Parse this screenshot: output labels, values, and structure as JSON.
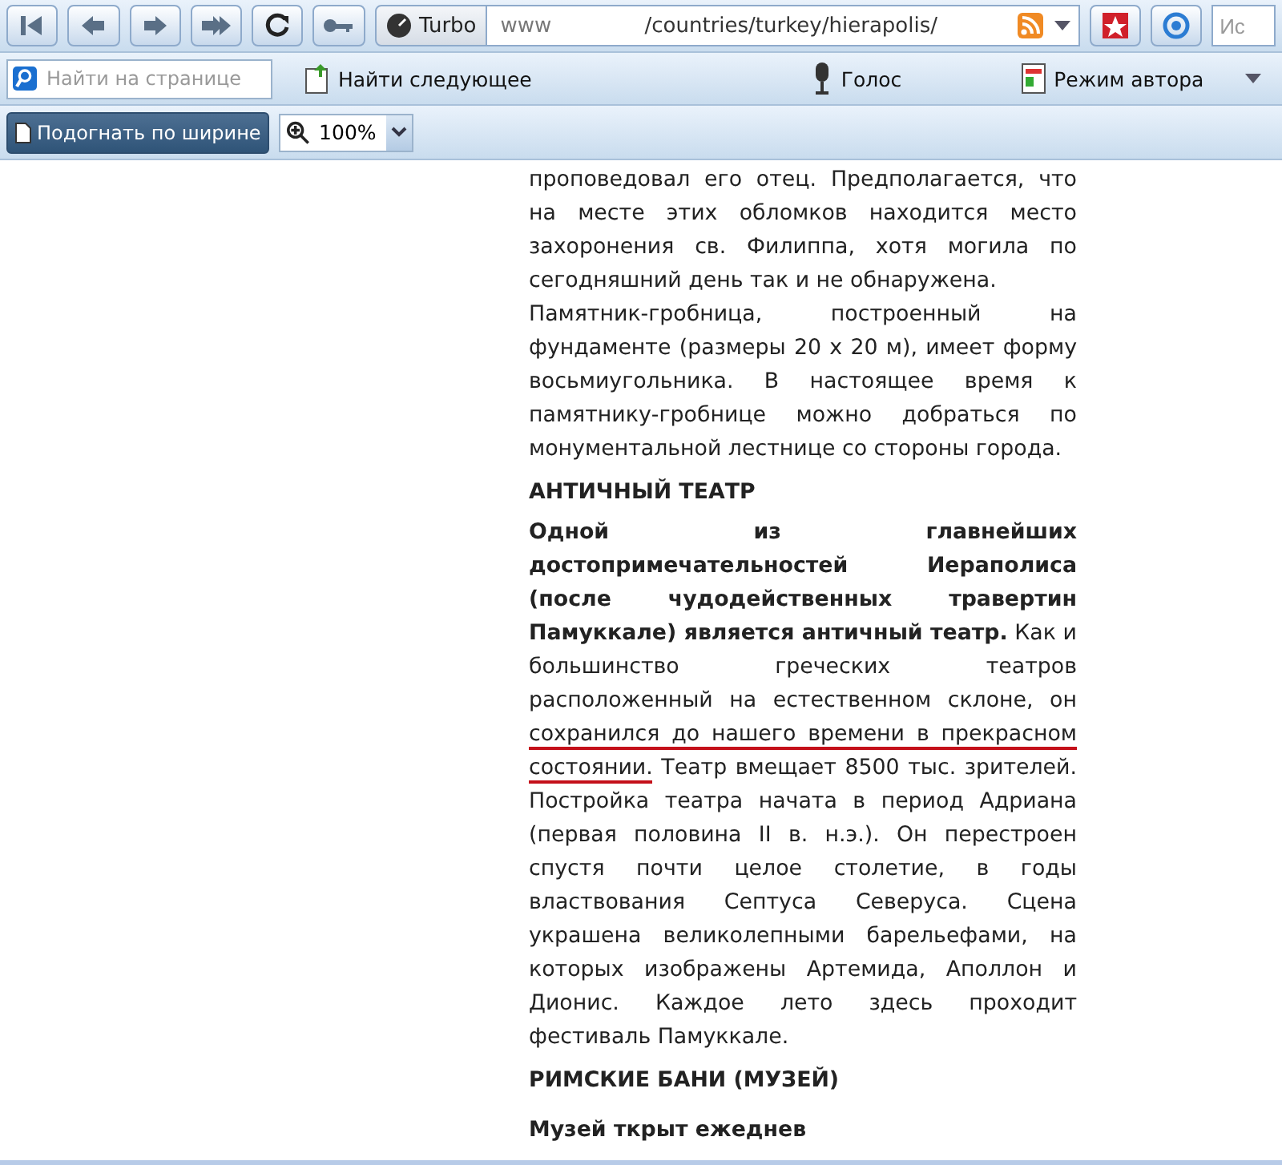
{
  "nav_toolbar": {
    "buttons": [
      {
        "kind": "first",
        "disabled": false
      },
      {
        "kind": "back",
        "disabled": false
      },
      {
        "kind": "forward",
        "disabled": false
      },
      {
        "kind": "fast-forward",
        "disabled": false
      },
      {
        "kind": "reload",
        "disabled": false
      },
      {
        "kind": "key",
        "disabled": false
      }
    ],
    "turbo": {
      "label": "Turbo"
    },
    "address": {
      "host": "www",
      "path": "/countries/turkey/hierapolis/"
    },
    "search": {
      "placeholder": "Ис"
    }
  },
  "find_bar": {
    "find_field": {
      "placeholder": "Найти на странице"
    },
    "find_next": "Найти следующее",
    "voice": "Голос",
    "author_mode": "Режим автора"
  },
  "zoom_bar": {
    "fit_width": {
      "label": "Подогнать по ширине",
      "selected": true
    },
    "zoom": "100%"
  },
  "article": [
    {
      "kind": "para",
      "segments": [
        {
          "kind": "plain",
          "text": "проповедовал его отец. Предполагается, что на месте этих обломков находится место захоронения св. Филиппа, хотя могила по сегодняшний день так и не обнаружена."
        }
      ]
    },
    {
      "kind": "para",
      "segments": [
        {
          "kind": "plain",
          "text": "Памятник-гробница, построенный на фундаменте (размеры 20 x 20 м), имеет форму восьмиугольника. В настоящее время к памятнику-гробнице можно добраться по монументальной лестнице со стороны города."
        }
      ]
    },
    {
      "kind": "heading",
      "segments": [
        {
          "kind": "plain",
          "text": "АНТИЧНЫЙ ТЕАТР"
        }
      ]
    },
    {
      "kind": "para",
      "segments": [
        {
          "kind": "bold",
          "text": "Одной из главнейших достопримечательностей Иераполиса (после чудодейственных травертин Памуккале) является античный театр."
        },
        {
          "kind": "plain",
          "text": " Как и большинство греческих театров расположенный на естественном склоне, он "
        },
        {
          "kind": "underlined",
          "text": "сохранился до нашего времени в прекрасном состоянии."
        },
        {
          "kind": "plain",
          "text": " Театр вмещает 8500 тыс. зрителей. Постройка театра начата в период Адриана (первая половина II в. н.э.). Он перестроен спустя почти целое столетие, в годы властвования Септуса Северуса. Сцена украшена великолепными барельефами, на которых изображены Артемида, Аполлон и Дионис. Каждое лето здесь проходит фестиваль Памуккале."
        }
      ]
    },
    {
      "kind": "heading",
      "segments": [
        {
          "kind": "plain",
          "text": "РИМСКИЕ БАНИ (МУЗЕЙ)"
        }
      ]
    },
    {
      "kind": "lead",
      "segments": [
        {
          "kind": "plain",
          "text": "Музей ткрыт ежеднев"
        }
      ]
    }
  ]
}
